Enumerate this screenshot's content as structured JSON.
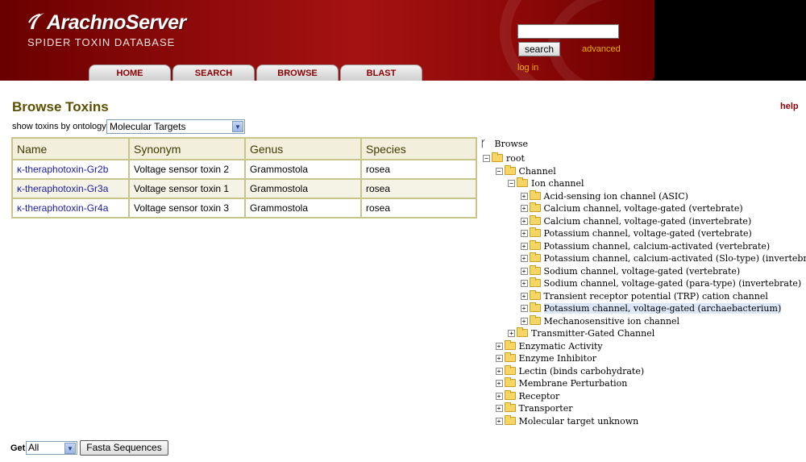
{
  "header": {
    "logo_title": "ArachnoServer",
    "logo_subtitle": "SPIDER TOXIN DATABASE",
    "nav_tabs": [
      {
        "label": "HOME"
      },
      {
        "label": "SEARCH"
      },
      {
        "label": "BROWSE"
      },
      {
        "label": "BLAST"
      }
    ],
    "search_value": "",
    "search_button": "search",
    "advanced_link": "advanced",
    "login_link": "log in"
  },
  "main": {
    "title": "Browse Toxins",
    "help_link": "help",
    "ontology_label": "show toxins by ontology:",
    "ontology_selected": "Molecular Targets",
    "table": {
      "headers": [
        "Name",
        "Synonym",
        "Genus",
        "Species"
      ],
      "rows": [
        [
          "κ-theraphotoxin-Gr2b",
          "Voltage sensor toxin 2",
          "Grammostola",
          "rosea"
        ],
        [
          "κ-theraphotoxin-Gr3a",
          "Voltage sensor toxin 1",
          "Grammostola",
          "rosea"
        ],
        [
          "κ-theraphotoxin-Gr4a",
          "Voltage sensor toxin 3",
          "Grammostola",
          "rosea"
        ]
      ]
    }
  },
  "tree": {
    "heading": "Browse",
    "nodes": [
      {
        "label": "root",
        "toggle": "−",
        "level": 0
      },
      {
        "label": "Channel",
        "toggle": "−",
        "level": 1
      },
      {
        "label": "Ion channel",
        "toggle": "−",
        "level": 2
      },
      {
        "label": "Acid-sensing ion channel (ASIC)",
        "toggle": "+",
        "level": 3
      },
      {
        "label": "Calcium channel, voltage-gated (vertebrate)",
        "toggle": "+",
        "level": 3
      },
      {
        "label": "Calcium channel, voltage-gated (invertebrate)",
        "toggle": "+",
        "level": 3
      },
      {
        "label": "Potassium channel, voltage-gated (vertebrate)",
        "toggle": "+",
        "level": 3
      },
      {
        "label": "Potassium channel, calcium-activated (vertebrate)",
        "toggle": "+",
        "level": 3
      },
      {
        "label": "Potassium channel, calcium-activated (Slo-type) (invertebrate)",
        "toggle": "+",
        "level": 3
      },
      {
        "label": "Sodium channel, voltage-gated (vertebrate)",
        "toggle": "+",
        "level": 3
      },
      {
        "label": "Sodium channel, voltage-gated (para-type) (invertebrate)",
        "toggle": "+",
        "level": 3
      },
      {
        "label": "Transient receptor potential (TRP) cation channel",
        "toggle": "+",
        "level": 3
      },
      {
        "label": "Potassium channel, voltage-gated (archaebacterium)",
        "toggle": "+",
        "level": 3,
        "selected": true
      },
      {
        "label": "Mechanosensitive ion channel",
        "toggle": "+",
        "level": 3
      },
      {
        "label": "Transmitter-Gated Channel",
        "toggle": "+",
        "level": 2
      },
      {
        "label": "Enzymatic Activity",
        "toggle": "+",
        "level": 1
      },
      {
        "label": "Enzyme Inhibitor",
        "toggle": "+",
        "level": 1
      },
      {
        "label": "Lectin (binds carbohydrate)",
        "toggle": "+",
        "level": 1
      },
      {
        "label": "Membrane Perturbation",
        "toggle": "+",
        "level": 1
      },
      {
        "label": "Receptor",
        "toggle": "+",
        "level": 1
      },
      {
        "label": "Transporter",
        "toggle": "+",
        "level": 1
      },
      {
        "label": "Molecular target unknown",
        "toggle": "+",
        "level": 1
      }
    ]
  },
  "footer": {
    "get_label": "Get",
    "get_selected": "All",
    "fasta_button": "Fasta Sequences"
  },
  "colors": {
    "banner_red": "#8e0a0a",
    "title_olive": "#5c5000",
    "link_blue": "#1a1aa0",
    "nav_text": "#8b0000",
    "link_gold": "#e8b000"
  }
}
